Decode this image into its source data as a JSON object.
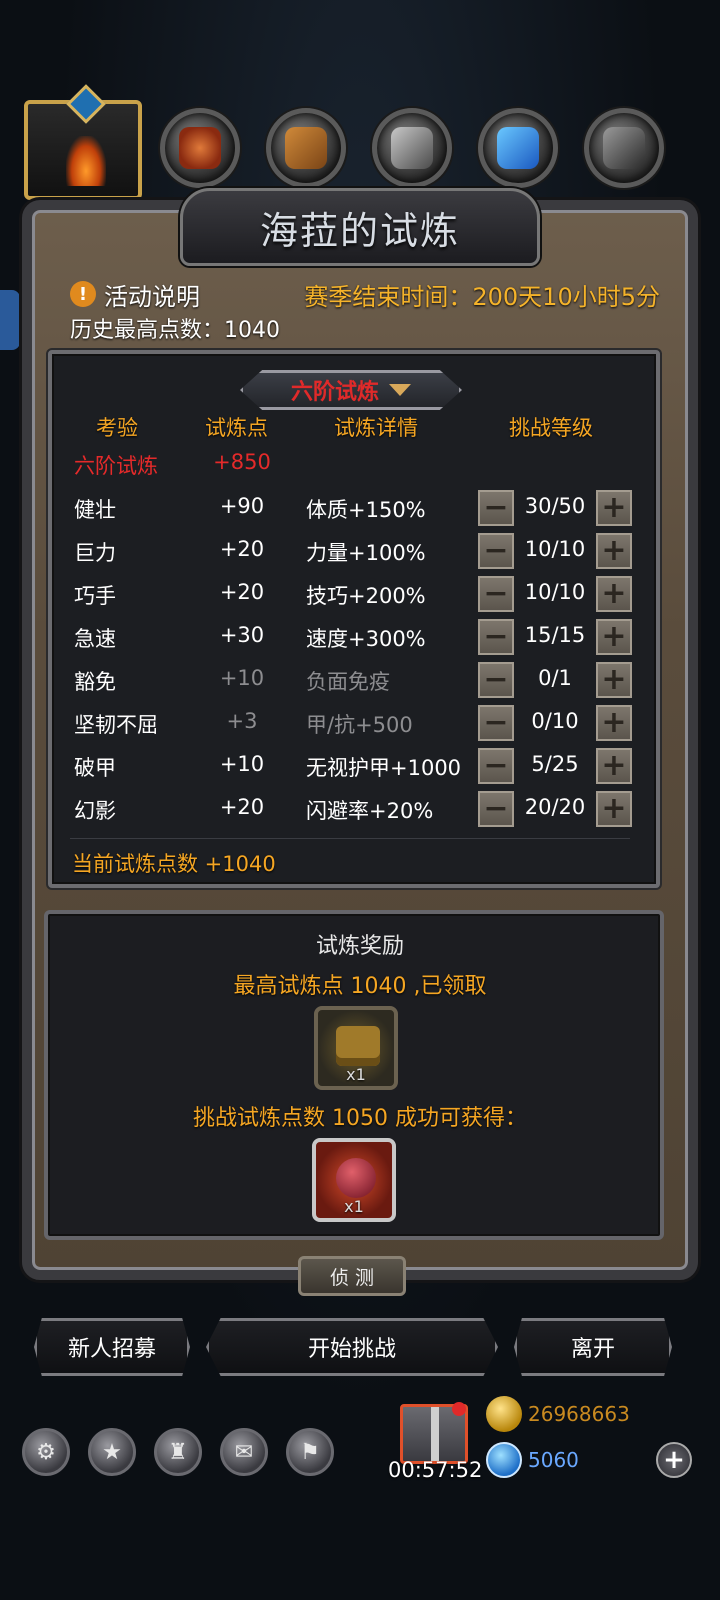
{
  "header": {
    "title": "海菈的试炼",
    "activity_label": "活动说明",
    "season_end": "赛季结束时间：200天10小时5分",
    "history_best": "历史最高点数：1040"
  },
  "trial": {
    "selected_tier": "六阶试炼",
    "columns": [
      "考验",
      "试炼点",
      "试炼详情",
      "挑战等级"
    ],
    "tier_row": {
      "name": "六阶试炼",
      "points": "+850"
    },
    "rows": [
      {
        "name": "健壮",
        "points": "+90",
        "detail": "体质+150%",
        "level": "30/50",
        "dim": false
      },
      {
        "name": "巨力",
        "points": "+20",
        "detail": "力量+100%",
        "level": "10/10",
        "dim": false
      },
      {
        "name": "巧手",
        "points": "+20",
        "detail": "技巧+200%",
        "level": "10/10",
        "dim": false
      },
      {
        "name": "急速",
        "points": "+30",
        "detail": "速度+300%",
        "level": "15/15",
        "dim": false
      },
      {
        "name": "豁免",
        "points": "+10",
        "detail": "负面免疫",
        "level": "0/1",
        "dim": true
      },
      {
        "name": "坚韧不屈",
        "points": "+3",
        "detail": "甲/抗+500",
        "level": "0/10",
        "dim": true
      },
      {
        "name": "破甲",
        "points": "+10",
        "detail": "无视护甲+1000",
        "level": "5/25",
        "dim": false
      },
      {
        "name": "幻影",
        "points": "+20",
        "detail": "闪避率+20%",
        "level": "20/20",
        "dim": false
      }
    ],
    "current_points": "当前试炼点数 +1040"
  },
  "rewards": {
    "title": "试炼奖励",
    "claimed_line": "最高试炼点 1040 ,已领取",
    "claimed_item_qty": "x1",
    "next_line": "挑战试炼点数 1050 成功可获得：",
    "next_item_qty": "x1"
  },
  "buttons": {
    "detect": "侦 测",
    "recruit": "新人招募",
    "start": "开始挑战",
    "leave": "离开"
  },
  "bottom": {
    "timer": "00:57:52",
    "gold": "26968663",
    "gems": "5060"
  },
  "colors": {
    "accent_orange": "#f5a623",
    "tier_red": "#e52a2a",
    "frame_brown": "#5a4c3c"
  },
  "icons": {
    "top": [
      "flame-crest-icon",
      "meat-icon",
      "wood-icon",
      "iron-icon",
      "crystal-icon",
      "stone-icon"
    ],
    "bottom": [
      "gear-icon",
      "star-badge-icon",
      "castle-icon",
      "mail-icon",
      "handshake-icon"
    ]
  }
}
